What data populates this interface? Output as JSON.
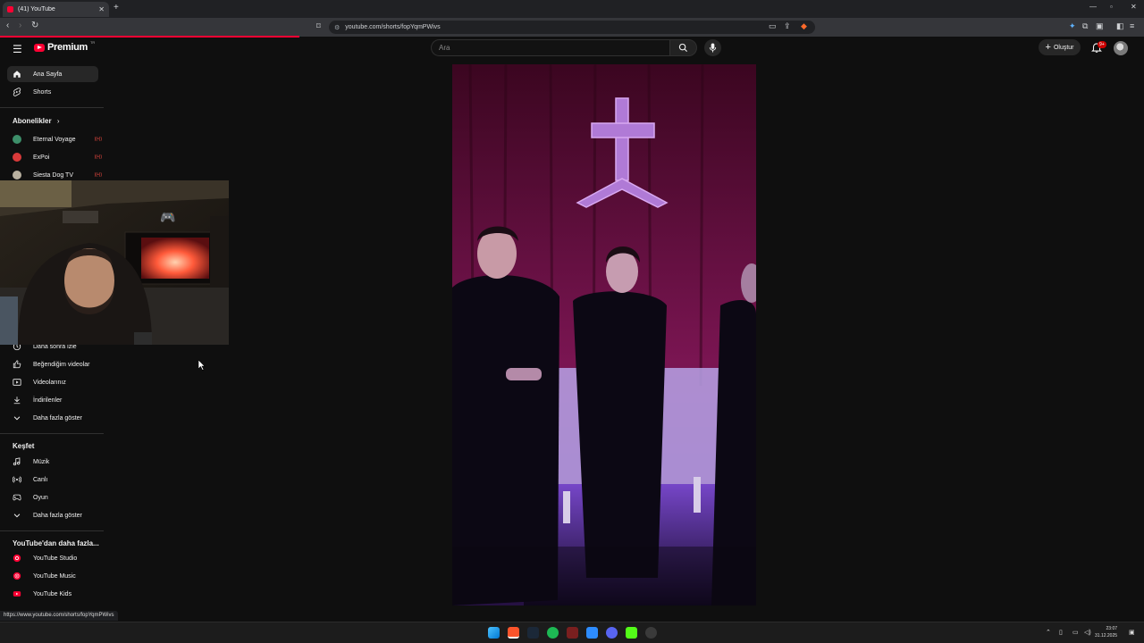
{
  "browser": {
    "tab_title": "(41) YouTube",
    "url": "youtube.com/shorts/fopYqmPWivs",
    "status_url": "https://www.youtube.com/shorts/fopYqmPWivs"
  },
  "masthead": {
    "logo_text": "Premium",
    "logo_tm": "TR",
    "search_placeholder": "Ara",
    "create_label": "Oluştur",
    "notification_badge": "9+"
  },
  "sidebar": {
    "main": [
      {
        "label": "Ana Sayfa",
        "icon": "home-icon"
      },
      {
        "label": "Shorts",
        "icon": "shorts-icon"
      }
    ],
    "subscriptions_heading": "Abonelikler",
    "subscriptions": [
      {
        "label": "Eternal Voyage",
        "color": "#3d8f6a"
      },
      {
        "label": "ExPoi",
        "color": "#d93a3a"
      },
      {
        "label": "Siesta Dog TV",
        "color": "#b8b0a0"
      }
    ],
    "you": [
      {
        "label": "Daha sonra izle",
        "icon": "clock-icon"
      },
      {
        "label": "Beğendiğim videolar",
        "icon": "thumbs-up-icon"
      },
      {
        "label": "Videolarınız",
        "icon": "play-square-icon"
      },
      {
        "label": "İndirilenler",
        "icon": "download-icon"
      },
      {
        "label": "Daha fazla göster",
        "icon": "chevron-down-icon"
      }
    ],
    "explore_heading": "Keşfet",
    "explore": [
      {
        "label": "Müzik",
        "icon": "music-icon"
      },
      {
        "label": "Canlı",
        "icon": "live-icon"
      },
      {
        "label": "Oyun",
        "icon": "game-icon"
      },
      {
        "label": "Daha fazla göster",
        "icon": "chevron-down-icon"
      }
    ],
    "more_heading": "YouTube'dan daha fazla...",
    "more": [
      {
        "label": "YouTube Studio",
        "icon": "youtube-studio-icon"
      },
      {
        "label": "YouTube Music",
        "icon": "youtube-music-icon"
      },
      {
        "label": "YouTube Kids",
        "icon": "youtube-kids-icon"
      }
    ]
  },
  "taskbar": {
    "time": "23:07",
    "date": "31.12.2025"
  },
  "colors": {
    "accent": "#ff0033",
    "background": "#0f0f0f"
  }
}
